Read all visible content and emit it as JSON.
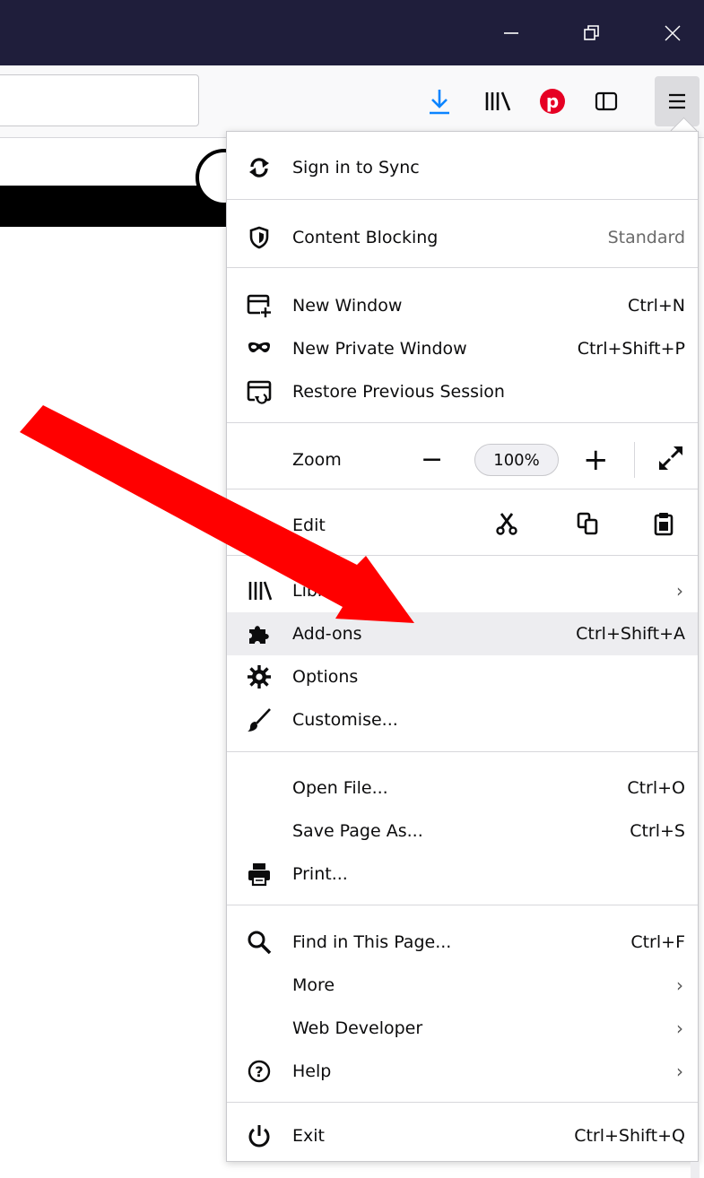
{
  "window": {
    "minimize_icon": "minimize-icon",
    "restore_icon": "restore-icon",
    "close_icon": "close-icon"
  },
  "toolbar": {
    "icons": [
      "download-icon",
      "library-icon",
      "pinterest-icon",
      "sidebar-icon",
      "hamburger-menu-icon"
    ],
    "accent": "#0a84ff",
    "pinterest_color": "#e60023"
  },
  "menu": {
    "sync": {
      "label": "Sign in to Sync",
      "icon": "sync-icon"
    },
    "content_blocking": {
      "label": "Content Blocking",
      "value": "Standard",
      "icon": "shield-icon"
    },
    "new_window": {
      "label": "New Window",
      "shortcut": "Ctrl+N",
      "icon": "new-window-icon"
    },
    "private_window": {
      "label": "New Private Window",
      "shortcut": "Ctrl+Shift+P",
      "icon": "mask-icon"
    },
    "restore_session": {
      "label": "Restore Previous Session",
      "icon": "restore-session-icon"
    },
    "zoom": {
      "label": "Zoom",
      "minus": "−",
      "level": "100%",
      "plus": "+",
      "icon": "fullscreen-icon"
    },
    "edit": {
      "label": "Edit",
      "icons": [
        "cut-icon",
        "copy-icon",
        "paste-icon"
      ]
    },
    "library": {
      "label": "Library",
      "icon": "library-icon"
    },
    "addons": {
      "label": "Add-ons",
      "shortcut": "Ctrl+Shift+A",
      "icon": "puzzle-icon"
    },
    "options": {
      "label": "Options",
      "icon": "gear-icon"
    },
    "customise": {
      "label": "Customise...",
      "icon": "brush-icon"
    },
    "open_file": {
      "label": "Open File...",
      "shortcut": "Ctrl+O"
    },
    "save_page": {
      "label": "Save Page As...",
      "shortcut": "Ctrl+S"
    },
    "print": {
      "label": "Print...",
      "icon": "printer-icon"
    },
    "find": {
      "label": "Find in This Page...",
      "shortcut": "Ctrl+F",
      "icon": "search-icon"
    },
    "more": {
      "label": "More"
    },
    "web_developer": {
      "label": "Web Developer"
    },
    "help": {
      "label": "Help",
      "icon": "help-icon"
    },
    "exit": {
      "label": "Exit",
      "shortcut": "Ctrl+Shift+Q",
      "icon": "power-icon"
    }
  },
  "annotation": {
    "arrow_color": "#ff0000"
  }
}
